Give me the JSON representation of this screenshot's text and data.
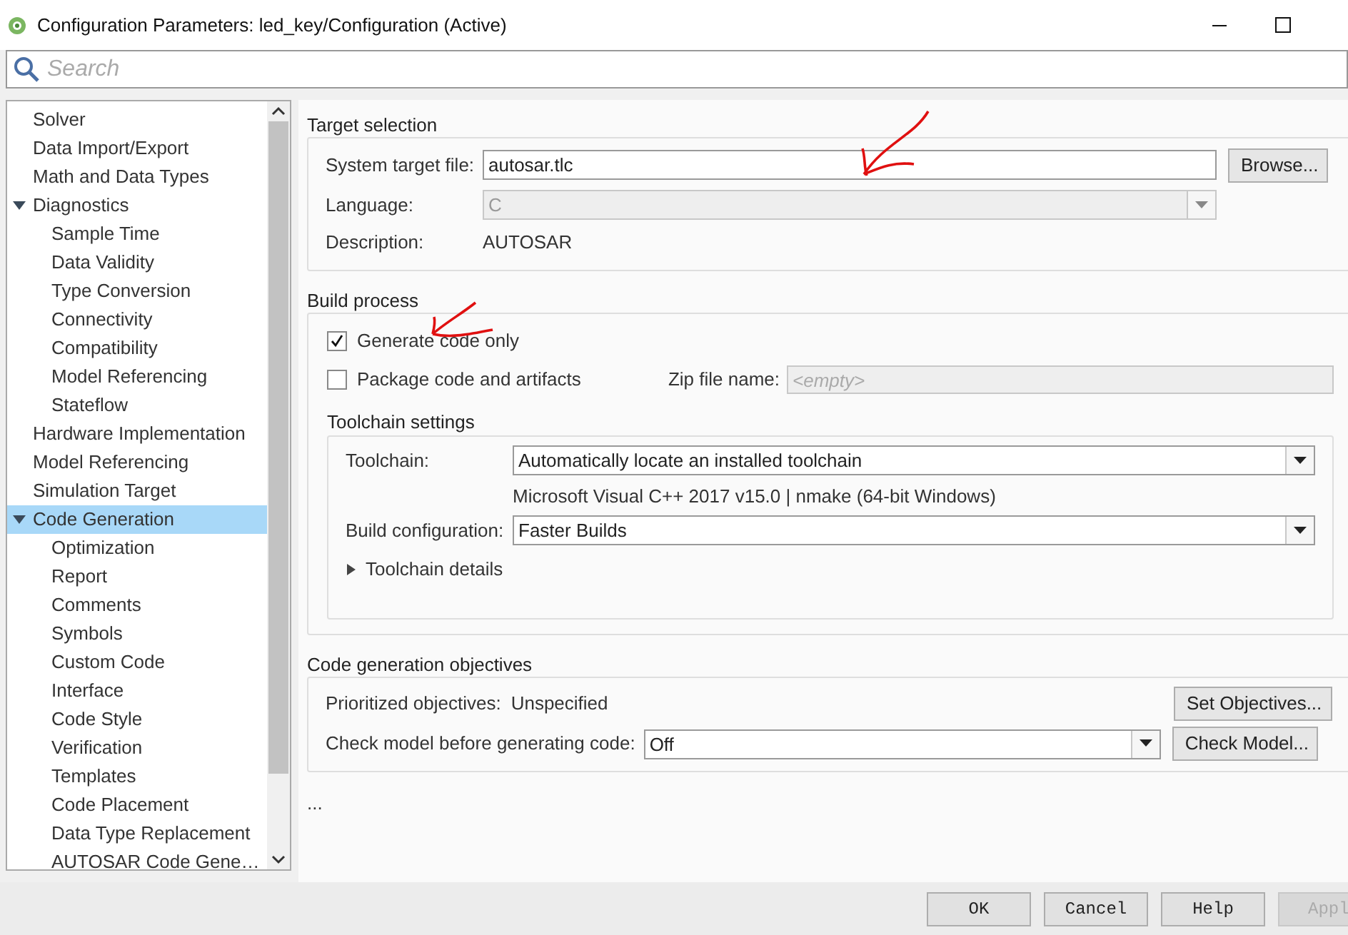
{
  "window": {
    "title": "Configuration Parameters: led_key/Configuration (Active)"
  },
  "search": {
    "placeholder": "Search"
  },
  "tree": [
    {
      "label": "Solver",
      "selected": false
    },
    {
      "label": "Data Import/Export",
      "selected": false
    },
    {
      "label": "Math and Data Types",
      "selected": false
    },
    {
      "label": "Diagnostics",
      "selected": false,
      "expanded": true,
      "children": [
        {
          "label": "Sample Time",
          "selected": false
        },
        {
          "label": "Data Validity",
          "selected": false
        },
        {
          "label": "Type Conversion",
          "selected": false
        },
        {
          "label": "Connectivity",
          "selected": false
        },
        {
          "label": "Compatibility",
          "selected": false
        },
        {
          "label": "Model Referencing",
          "selected": false
        },
        {
          "label": "Stateflow",
          "selected": false
        }
      ]
    },
    {
      "label": "Hardware Implementation",
      "selected": false
    },
    {
      "label": "Model Referencing",
      "selected": false
    },
    {
      "label": "Simulation Target",
      "selected": false
    },
    {
      "label": "Code Generation",
      "selected": true,
      "expanded": true,
      "children": [
        {
          "label": "Optimization",
          "selected": false
        },
        {
          "label": "Report",
          "selected": false
        },
        {
          "label": "Comments",
          "selected": false
        },
        {
          "label": "Symbols",
          "selected": false
        },
        {
          "label": "Custom Code",
          "selected": false
        },
        {
          "label": "Interface",
          "selected": false
        },
        {
          "label": "Code Style",
          "selected": false
        },
        {
          "label": "Verification",
          "selected": false
        },
        {
          "label": "Templates",
          "selected": false
        },
        {
          "label": "Code Placement",
          "selected": false
        },
        {
          "label": "Data Type Replacement",
          "selected": false
        },
        {
          "label": "AUTOSAR Code Gene…",
          "selected": false
        }
      ]
    }
  ],
  "target_selection": {
    "title": "Target selection",
    "system_target_file": {
      "label": "System target file:",
      "value": "autosar.tlc"
    },
    "browse_button": "Browse...",
    "language": {
      "label": "Language:",
      "value": "C",
      "disabled": true
    },
    "description": {
      "label": "Description:",
      "value": "AUTOSAR"
    }
  },
  "build_process": {
    "title": "Build process",
    "checkboxes": [
      {
        "label": "Generate code only",
        "checked": true
      },
      {
        "label": "Package code and artifacts",
        "checked": false
      }
    ],
    "zip_file": {
      "label": "Zip file name:",
      "placeholder": "<empty>",
      "disabled": true
    },
    "toolchain_settings": {
      "title": "Toolchain settings",
      "toolchain": {
        "label": "Toolchain:",
        "value": "Automatically locate an installed toolchain"
      },
      "toolchain_note": "Microsoft Visual C++ 2017 v15.0 | nmake (64-bit Windows)",
      "build_configuration": {
        "label": "Build configuration:",
        "value": "Faster Builds"
      },
      "details": {
        "label": "Toolchain details",
        "expanded": false
      }
    }
  },
  "objectives": {
    "title": "Code generation objectives",
    "prioritized": {
      "label": "Prioritized objectives:",
      "value": "Unspecified"
    },
    "set_button": "Set Objectives...",
    "check_model": {
      "label": "Check model before generating code:",
      "value": "Off"
    },
    "check_button": "Check Model..."
  },
  "more": "...",
  "buttons": [
    {
      "label": "OK",
      "disabled": false
    },
    {
      "label": "Cancel",
      "disabled": false
    },
    {
      "label": "Help",
      "disabled": false
    },
    {
      "label": "Appl",
      "disabled": true
    }
  ]
}
